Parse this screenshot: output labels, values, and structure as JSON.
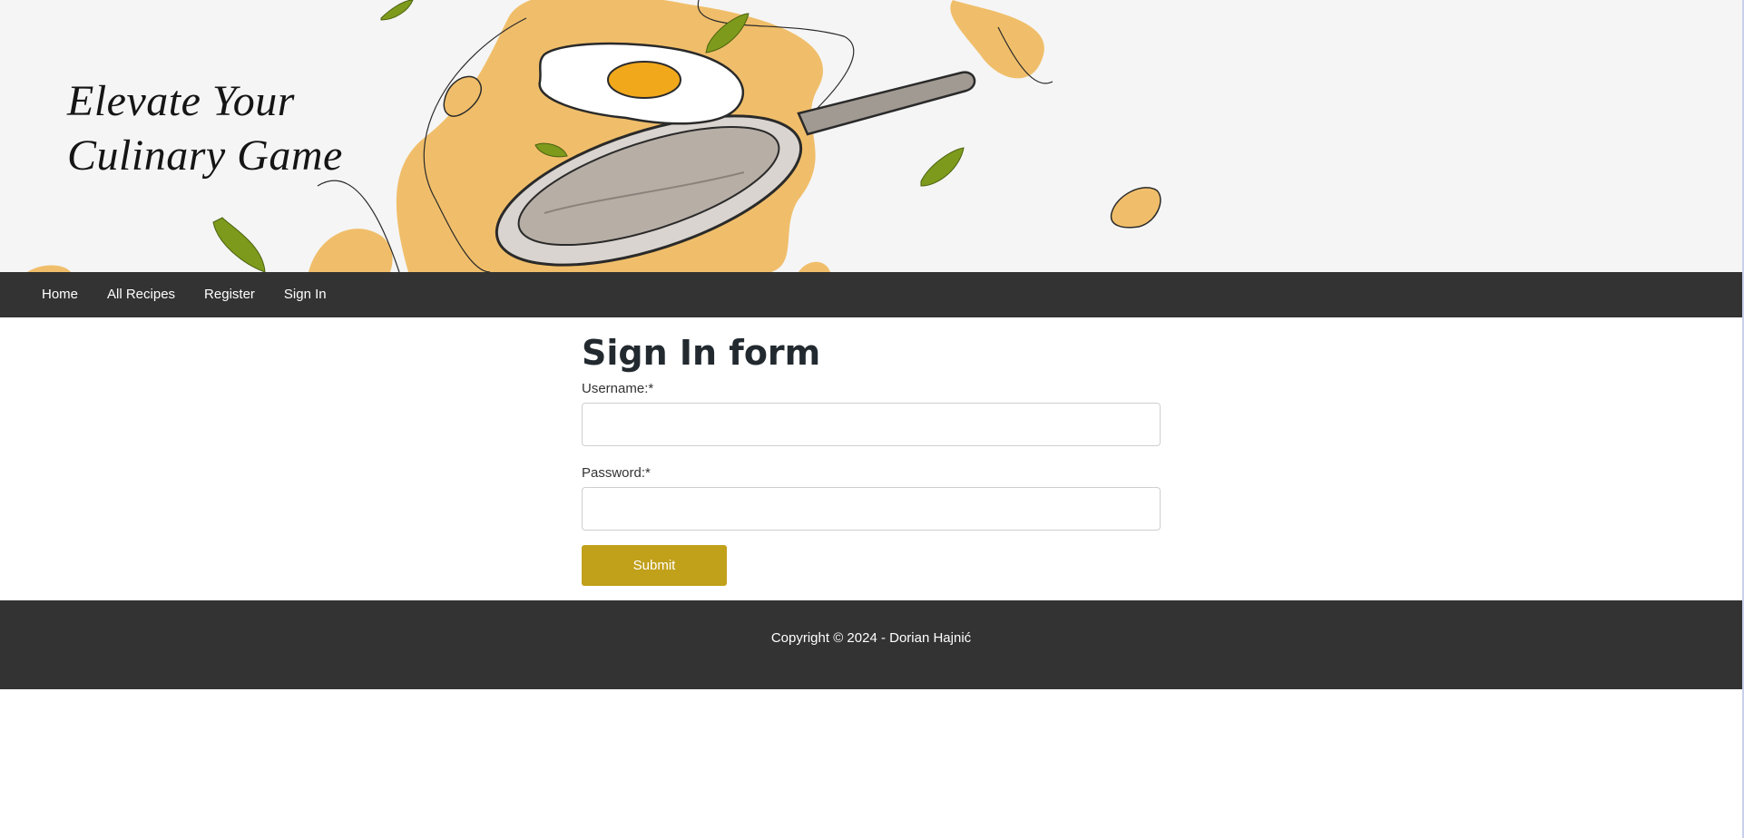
{
  "hero": {
    "title_line1": "Elevate Your",
    "title_line2": "Culinary Game",
    "illustration": [
      "fried-egg",
      "frying-pan",
      "herb-leaves",
      "orange-splash"
    ],
    "colors": {
      "splash": "#f0be6a",
      "leaf": "#7d9a1c",
      "yolk": "#f2a81b",
      "background": "#f5f5f5"
    }
  },
  "nav": {
    "items": [
      {
        "label": "Home"
      },
      {
        "label": "All Recipes"
      },
      {
        "label": "Register"
      },
      {
        "label": "Sign In"
      }
    ]
  },
  "form": {
    "title": "Sign In form",
    "username_label": "Username:*",
    "username_value": "",
    "password_label": "Password:*",
    "password_value": "",
    "submit_label": "Submit"
  },
  "footer": {
    "text": "Copyright © 2024 - Dorian Hajnić"
  },
  "colors": {
    "nav_bg": "#333333",
    "footer_bg": "#333333",
    "submit_bg": "#c1a01a"
  }
}
